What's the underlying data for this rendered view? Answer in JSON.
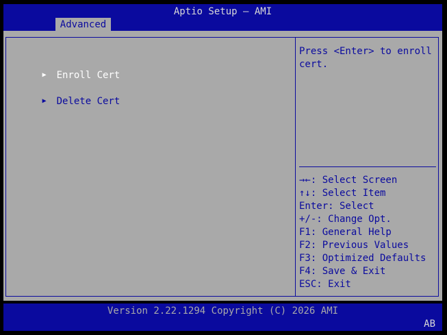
{
  "header": {
    "title": "Aptio Setup – AMI",
    "tab": "Advanced"
  },
  "menu": {
    "items": [
      {
        "label": "Enroll Cert",
        "arrow": "▶",
        "selected": true
      },
      {
        "label": "Delete Cert",
        "arrow": "▶",
        "selected": false
      }
    ]
  },
  "help": {
    "text": "Press <Enter> to enroll cert."
  },
  "keys": [
    "→←: Select Screen",
    "↑↓: Select Item",
    "Enter: Select",
    "+/-: Change Opt.",
    "F1: General Help",
    "F2: Previous Values",
    "F3: Optimized Defaults",
    "F4: Save & Exit",
    "ESC: Exit"
  ],
  "footer": {
    "version": "Version 2.22.1294 Copyright (C) 2026 AMI",
    "badge": "AB"
  },
  "colors": {
    "bios_blue": "#0a0a9e",
    "panel_gray": "#a9a9a9",
    "selected_text": "#ffffff",
    "background": "#000000"
  }
}
